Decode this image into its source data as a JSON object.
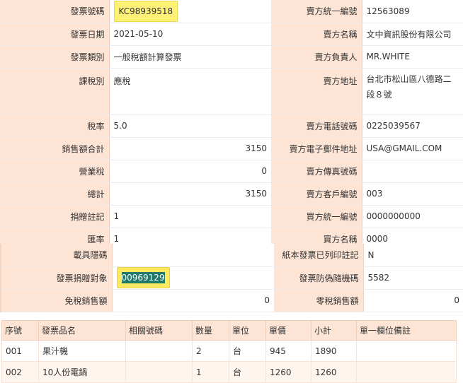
{
  "invoice": {
    "rows": [
      {
        "l1": "發票號碼",
        "v1": "KC98939518",
        "l2": "賣方統一編號",
        "v2": "12563089"
      },
      {
        "l1": "發票日期",
        "v1": "2021-05-10",
        "l2": "賣方名稱",
        "v2": "文中資訊股份有限公司"
      },
      {
        "l1": "發票類別",
        "v1": "一般稅額計算發票",
        "l2": "賣方負責人",
        "v2": "MR.WHITE"
      },
      {
        "l1": "課稅別",
        "v1": "應稅",
        "l2": "賣方地址",
        "v2": "台北市松山區八德路二段８號"
      },
      {
        "l1": "稅率",
        "v1": "5.0",
        "l2": "賣方電話號碼",
        "v2": "0225039567"
      },
      {
        "l1": "銷售額合計",
        "v1": "3150",
        "l2": "賣方電子郵件地址",
        "v2": "USA@GMAIL.COM"
      },
      {
        "l1": "營業稅",
        "v1": "0",
        "l2": "賣方傳真號碼",
        "v2": ""
      },
      {
        "l1": "總計",
        "v1": "3150",
        "l2": "賣方客戶編號",
        "v2": "003"
      },
      {
        "l1": "捐贈註記",
        "v1": "1",
        "l2": "買方統一編號",
        "v2": "0000000000"
      },
      {
        "l1": "匯率",
        "v1": "1",
        "l2": "買方名稱",
        "v2": "0000"
      }
    ]
  },
  "extra": {
    "rows": [
      {
        "l1": "載具隱碼",
        "v1": "",
        "l2": "紙本發票已列印註記",
        "v2": "N"
      },
      {
        "l1": "發票捐贈對象",
        "v1": "00969129",
        "l2": "發票防偽隨機碼",
        "v2": "5582"
      },
      {
        "l1": "免稅銷售額",
        "v1": "0",
        "l2": "零稅銷售額",
        "v2": "0"
      }
    ]
  },
  "items": {
    "headers": [
      "序號",
      "發票品名",
      "相關號碼",
      "數量",
      "單位",
      "單價",
      "小計",
      "單一欄位備註"
    ],
    "rows": [
      [
        "001",
        "果汁機",
        "",
        "2",
        "台",
        "945",
        "1890",
        ""
      ],
      [
        "002",
        "10人份電鍋",
        "",
        "1",
        "台",
        "1260",
        "1260",
        ""
      ]
    ]
  }
}
